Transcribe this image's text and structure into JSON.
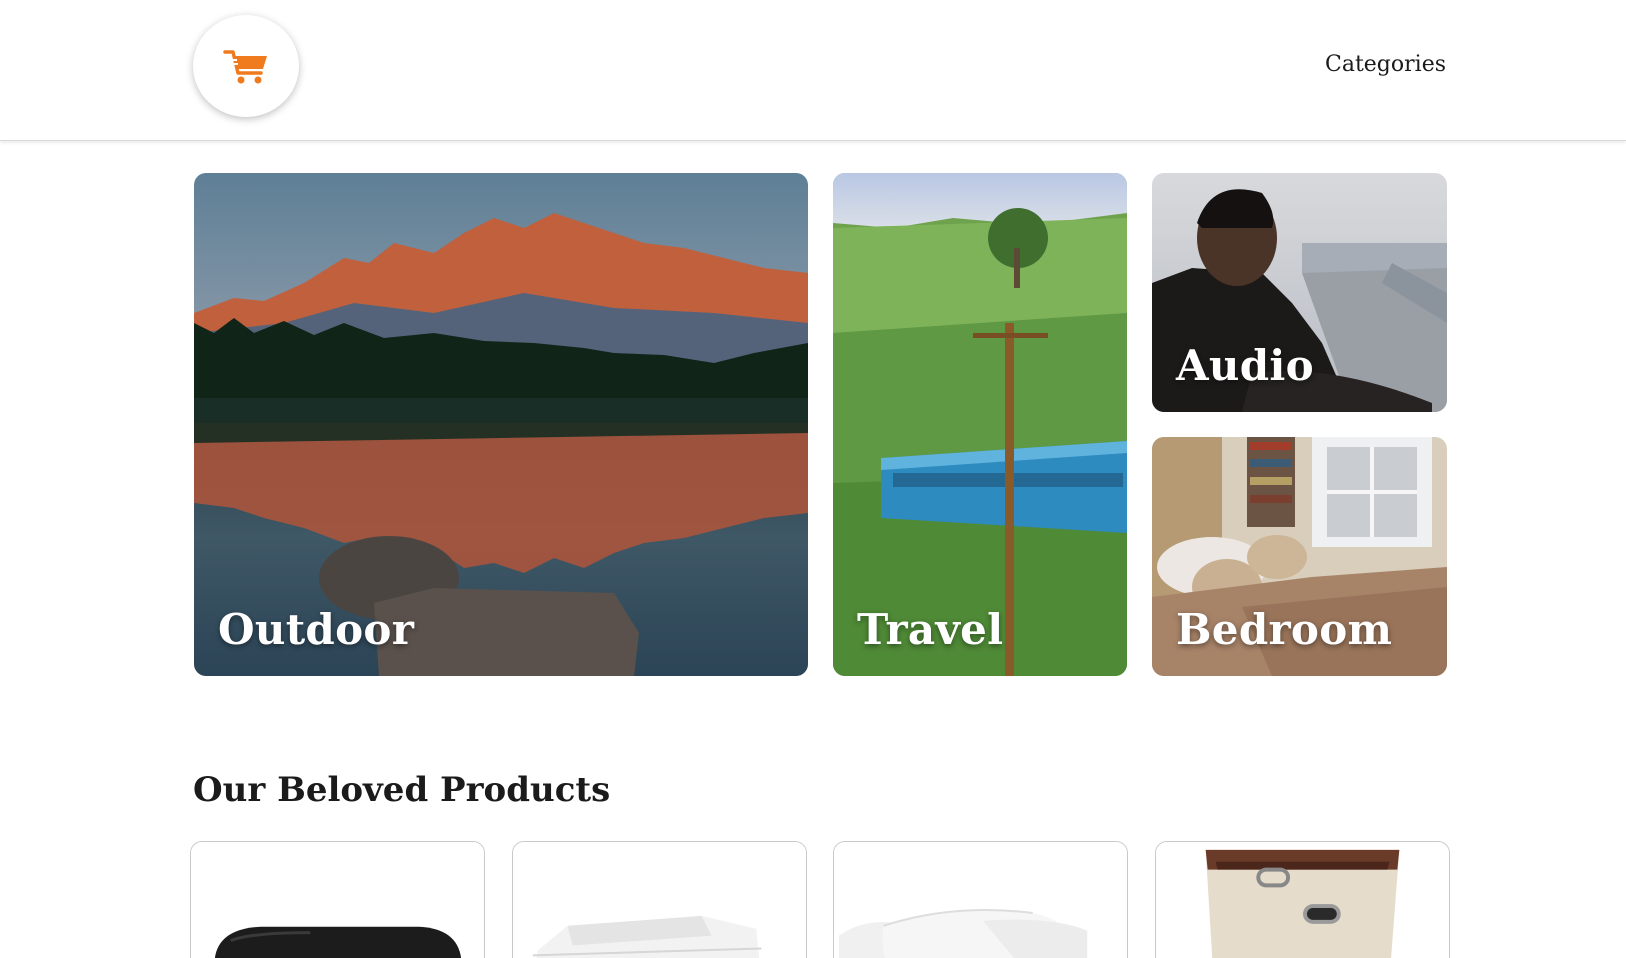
{
  "header": {
    "logo_icon": "shopping-cart-icon",
    "accent_color": "#f07b1e",
    "nav": {
      "categories_label": "Categories"
    }
  },
  "categories": [
    {
      "label": "Outdoor"
    },
    {
      "label": "Travel"
    },
    {
      "label": "Audio"
    },
    {
      "label": "Bedroom"
    }
  ],
  "products_section": {
    "title": "Our Beloved Products",
    "products": [
      {
        "image": "black-cushion-photo"
      },
      {
        "image": "white-sheets-photo"
      },
      {
        "image": "white-pillows-photo"
      },
      {
        "image": "storage-bin-photo"
      }
    ]
  }
}
